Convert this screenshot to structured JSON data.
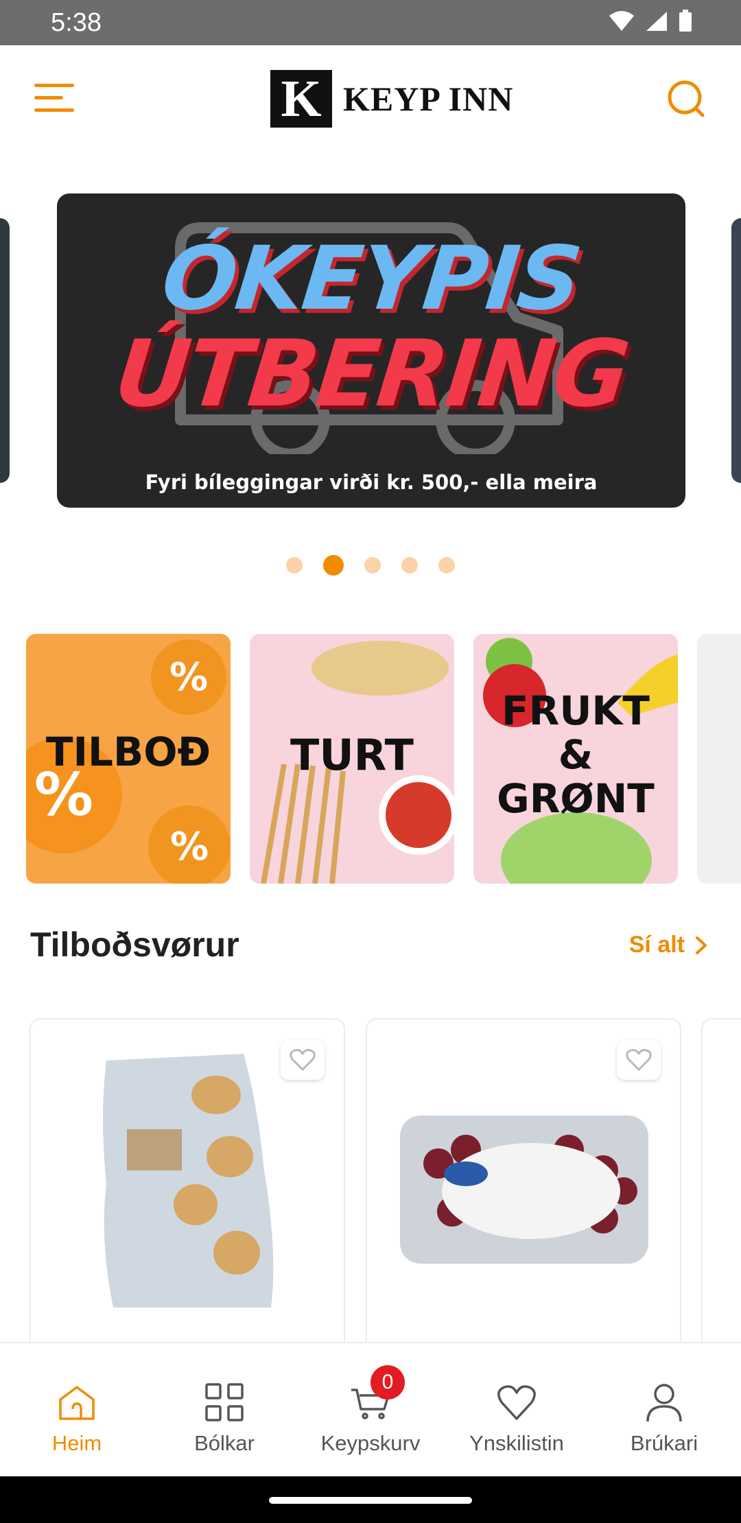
{
  "status_bar": {
    "time": "5:38"
  },
  "header": {
    "logo_letter": "K",
    "logo_text": "KEYP INN"
  },
  "banner": {
    "line1": "ÓKEYPIS",
    "line2": "ÚTBERING",
    "subtitle": "Fyri bíleggingar virði kr. 500,- ella meira",
    "dot_count": 5,
    "active_dot": 2
  },
  "categories": [
    {
      "label": "TILBOÐ"
    },
    {
      "label": "TURT"
    },
    {
      "label": "FRUKT & GRØNT"
    }
  ],
  "category_percent_symbol": "%",
  "section": {
    "title": "Tilboðsvørur",
    "see_all": "Sí alt"
  },
  "products": [
    {
      "image": "mini-flutes-bread-bag"
    },
    {
      "image": "red-seedless-grapes"
    }
  ],
  "bottom_nav": {
    "items": [
      {
        "label": "Heim",
        "icon": "home-icon",
        "active": true
      },
      {
        "label": "Bólkar",
        "icon": "grid-icon",
        "active": false
      },
      {
        "label": "Keypskurv",
        "icon": "cart-icon",
        "active": false,
        "badge": "0"
      },
      {
        "label": "Ynskilistin",
        "icon": "heart-icon",
        "active": false
      },
      {
        "label": "Brúkari",
        "icon": "user-icon",
        "active": false
      }
    ]
  },
  "colors": {
    "accent": "#f08c00",
    "badge": "#e31b23",
    "banner_bg": "#262626"
  }
}
